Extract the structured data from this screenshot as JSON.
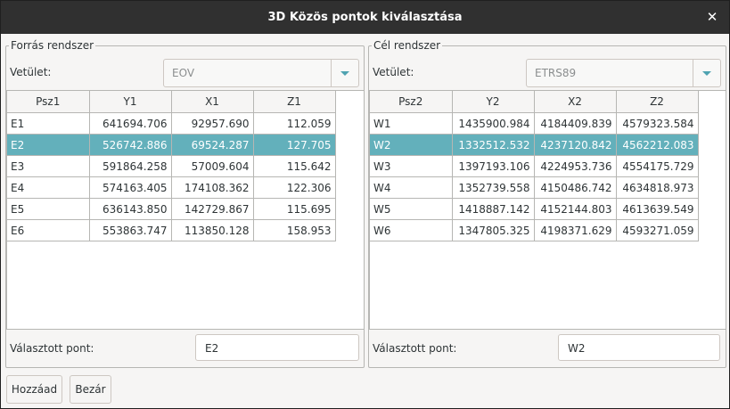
{
  "window": {
    "title": "3D Közös pontok kiválasztása",
    "close_icon": "close-icon"
  },
  "source": {
    "group_title": "Forrás rendszer",
    "projection_label": "Vetület:",
    "projection_value": "EOV",
    "columns": [
      "Psz1",
      "Y1",
      "X1",
      "Z1"
    ],
    "rows": [
      [
        "E1",
        "641694.706",
        "92957.690",
        "112.059"
      ],
      [
        "E2",
        "526742.886",
        "69524.287",
        "127.705"
      ],
      [
        "E3",
        "591864.258",
        "57009.604",
        "115.642"
      ],
      [
        "E4",
        "574163.405",
        "174108.362",
        "122.306"
      ],
      [
        "E5",
        "636143.850",
        "142729.867",
        "115.695"
      ],
      [
        "E6",
        "553863.747",
        "113850.128",
        "158.953"
      ]
    ],
    "selected_row": 1,
    "selected_label": "Választott pont:",
    "selected_value": "E2"
  },
  "target": {
    "group_title": "Cél rendszer",
    "projection_label": "Vetület:",
    "projection_value": "ETRS89",
    "columns": [
      "Psz2",
      "Y2",
      "X2",
      "Z2"
    ],
    "rows": [
      [
        "W1",
        "1435900.984",
        "4184409.839",
        "4579323.584"
      ],
      [
        "W2",
        "1332512.532",
        "4237120.842",
        "4562212.083"
      ],
      [
        "W3",
        "1397193.106",
        "4224953.736",
        "4554175.729"
      ],
      [
        "W4",
        "1352739.558",
        "4150486.742",
        "4634818.973"
      ],
      [
        "W5",
        "1418887.142",
        "4152144.803",
        "4613639.549"
      ],
      [
        "W6",
        "1347805.325",
        "4198371.629",
        "4593271.059"
      ]
    ],
    "selected_row": 1,
    "selected_label": "Választott pont:",
    "selected_value": "W2"
  },
  "buttons": {
    "add_label": "Hozzáad",
    "close_label": "Bezár"
  },
  "colors": {
    "titlebar": "#303030",
    "selection": "#63b0bb",
    "accent": "#4fa3b1"
  }
}
